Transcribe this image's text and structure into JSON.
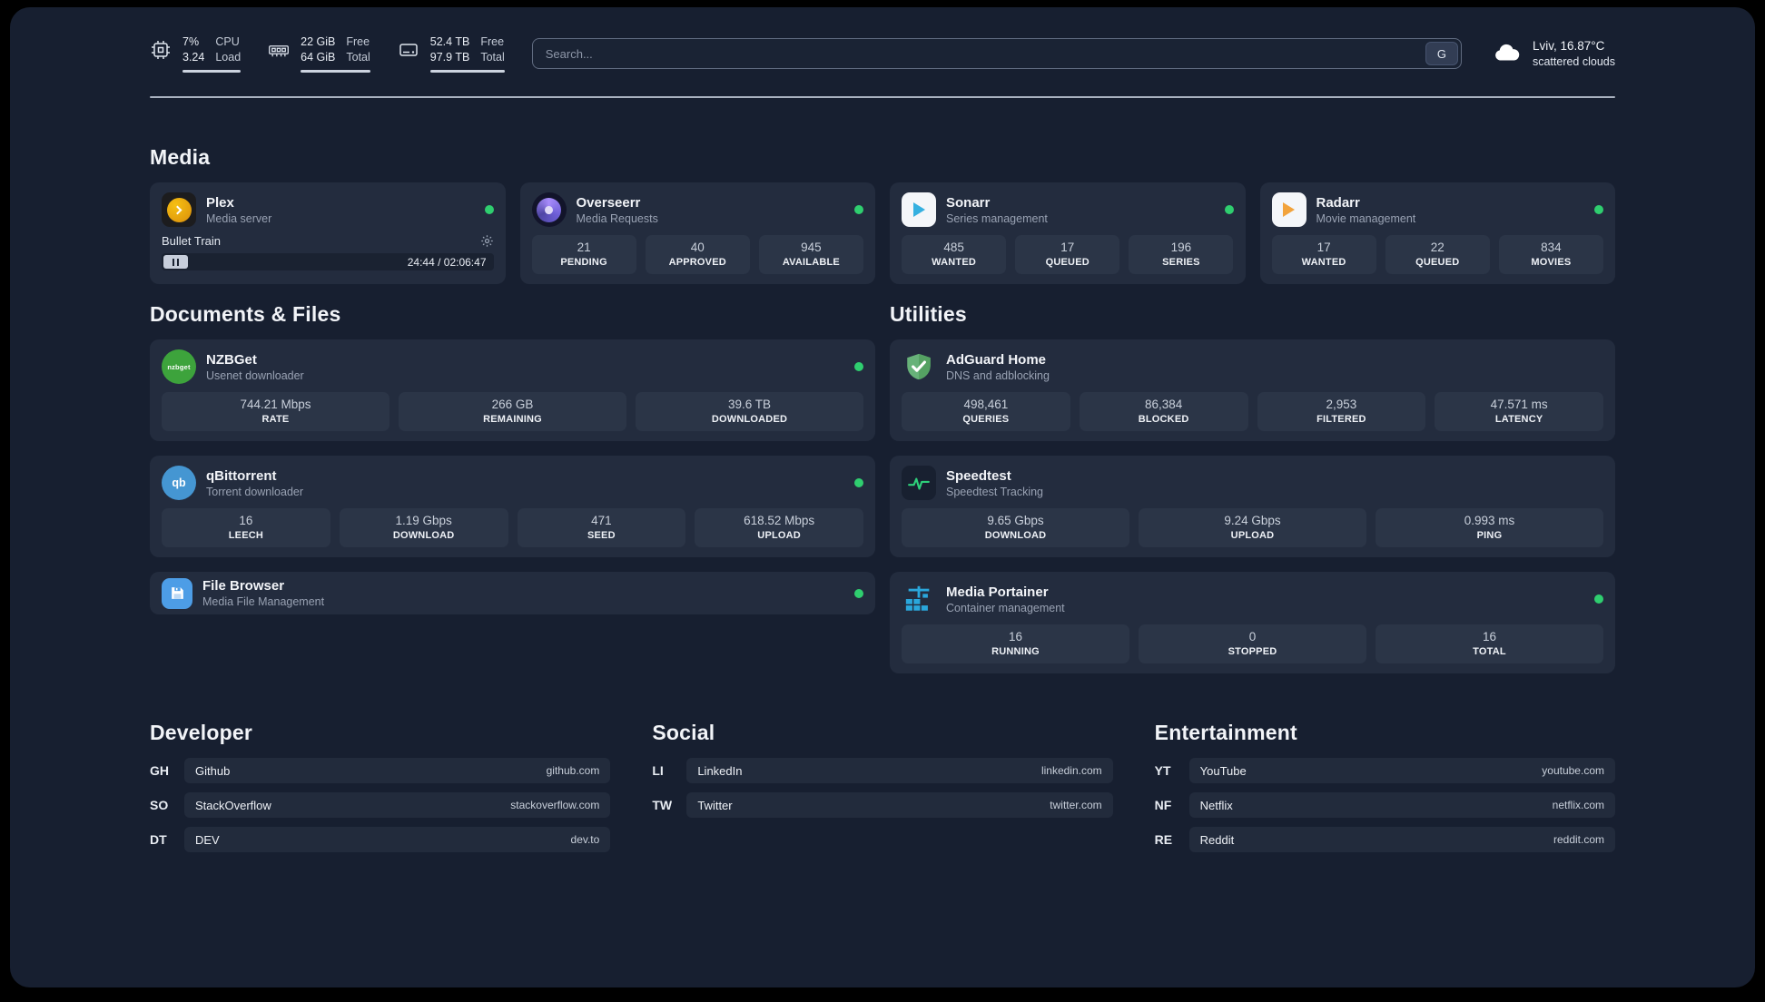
{
  "colors": {
    "background": "#171f30",
    "card": "#232c3e",
    "stat_tile": "#2b3547",
    "status_online": "#2fce6f",
    "plex_accent": "#e5a00d"
  },
  "header": {
    "cpu": {
      "percent": "7%",
      "load": "3.24",
      "label_top": "CPU",
      "label_bottom": "Load"
    },
    "ram": {
      "free": "22 GiB",
      "total": "64 GiB",
      "label_top": "Free",
      "label_bottom": "Total"
    },
    "disk": {
      "free": "52.4 TB",
      "total": "97.9 TB",
      "label_top": "Free",
      "label_bottom": "Total"
    },
    "search": {
      "placeholder": "Search...",
      "button_label": "G"
    },
    "weather": {
      "location": "Lviv, 16.87°C",
      "condition": "scattered clouds"
    }
  },
  "media": {
    "title": "Media",
    "plex": {
      "name": "Plex",
      "subtitle": "Media server",
      "now_playing": "Bullet Train",
      "time": "24:44 / 02:06:47"
    },
    "cards": [
      {
        "name": "Overseerr",
        "subtitle": "Media Requests",
        "stats": [
          {
            "value": "21",
            "label": "PENDING"
          },
          {
            "value": "40",
            "label": "APPROVED"
          },
          {
            "value": "945",
            "label": "AVAILABLE"
          }
        ]
      },
      {
        "name": "Sonarr",
        "subtitle": "Series management",
        "stats": [
          {
            "value": "485",
            "label": "WANTED"
          },
          {
            "value": "17",
            "label": "QUEUED"
          },
          {
            "value": "196",
            "label": "SERIES"
          }
        ]
      },
      {
        "name": "Radarr",
        "subtitle": "Movie management",
        "stats": [
          {
            "value": "17",
            "label": "WANTED"
          },
          {
            "value": "22",
            "label": "QUEUED"
          },
          {
            "value": "834",
            "label": "MOVIES"
          }
        ]
      }
    ]
  },
  "documents": {
    "title": "Documents & Files",
    "cards": [
      {
        "name": "NZBGet",
        "subtitle": "Usenet downloader",
        "icon_text": "nzbget",
        "stats": [
          {
            "value": "744.21 Mbps",
            "label": "RATE"
          },
          {
            "value": "266 GB",
            "label": "REMAINING"
          },
          {
            "value": "39.6 TB",
            "label": "DOWNLOADED"
          }
        ]
      },
      {
        "name": "qBittorrent",
        "subtitle": "Torrent downloader",
        "icon_text": "qb",
        "stats": [
          {
            "value": "16",
            "label": "LEECH"
          },
          {
            "value": "1.19 Gbps",
            "label": "DOWNLOAD"
          },
          {
            "value": "471",
            "label": "SEED"
          },
          {
            "value": "618.52 Mbps",
            "label": "UPLOAD"
          }
        ]
      },
      {
        "name": "File Browser",
        "subtitle": "Media File Management"
      }
    ]
  },
  "utilities": {
    "title": "Utilities",
    "cards": [
      {
        "name": "AdGuard Home",
        "subtitle": "DNS and adblocking",
        "stats": [
          {
            "value": "498,461",
            "label": "QUERIES"
          },
          {
            "value": "86,384",
            "label": "BLOCKED"
          },
          {
            "value": "2,953",
            "label": "FILTERED"
          },
          {
            "value": "47.571 ms",
            "label": "LATENCY"
          }
        ]
      },
      {
        "name": "Speedtest",
        "subtitle": "Speedtest Tracking",
        "stats": [
          {
            "value": "9.65 Gbps",
            "label": "DOWNLOAD"
          },
          {
            "value": "9.24 Gbps",
            "label": "UPLOAD"
          },
          {
            "value": "0.993 ms",
            "label": "PING"
          }
        ]
      },
      {
        "name": "Media Portainer",
        "subtitle": "Container management",
        "stats": [
          {
            "value": "16",
            "label": "RUNNING"
          },
          {
            "value": "0",
            "label": "STOPPED"
          },
          {
            "value": "16",
            "label": "TOTAL"
          }
        ]
      }
    ]
  },
  "bookmarks": [
    {
      "title": "Developer",
      "items": [
        {
          "abbr": "GH",
          "name": "Github",
          "domain": "github.com"
        },
        {
          "abbr": "SO",
          "name": "StackOverflow",
          "domain": "stackoverflow.com"
        },
        {
          "abbr": "DT",
          "name": "DEV",
          "domain": "dev.to"
        }
      ]
    },
    {
      "title": "Social",
      "items": [
        {
          "abbr": "LI",
          "name": "LinkedIn",
          "domain": "linkedin.com"
        },
        {
          "abbr": "TW",
          "name": "Twitter",
          "domain": "twitter.com"
        }
      ]
    },
    {
      "title": "Entertainment",
      "items": [
        {
          "abbr": "YT",
          "name": "YouTube",
          "domain": "youtube.com"
        },
        {
          "abbr": "NF",
          "name": "Netflix",
          "domain": "netflix.com"
        },
        {
          "abbr": "RE",
          "name": "Reddit",
          "domain": "reddit.com"
        }
      ]
    }
  ]
}
